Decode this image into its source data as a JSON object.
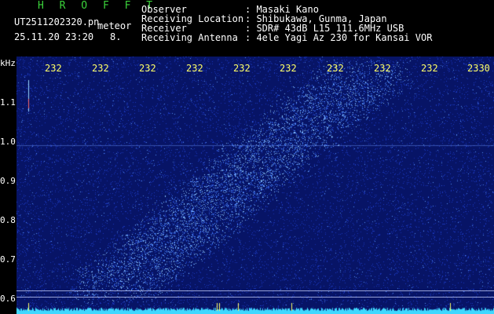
{
  "header": {
    "title": "H R O F F T",
    "filename": "UT2511202320.pn",
    "meteor_label": "meteor",
    "timestamp": "25.11.20 23:20",
    "count": "8.",
    "fields": [
      {
        "label": "Observer",
        "value": ": Masaki Kano"
      },
      {
        "label": "Receiving Location",
        "value": ": Shibukawa, Gunma, Japan"
      },
      {
        "label": "Receiver",
        "value": ": SDR# 43dB L15 111.6MHz USB"
      },
      {
        "label": "Receiving Antenna",
        "value": ": 4ele Yagi Az 230 for Kansai VOR"
      }
    ]
  },
  "axis": {
    "unit": "kHz",
    "y_ticks": [
      "1.1",
      "1.0",
      "0.9",
      "0.8",
      "0.7",
      "0.6"
    ],
    "x_ticks": [
      "232",
      "232",
      "232",
      "232",
      "232",
      "232",
      "232",
      "232",
      "232",
      "2330"
    ]
  },
  "colors": {
    "background": "#000000",
    "spectrogram": "#0a1a7a",
    "signal": "#4aa8ff",
    "noise_floor": "#3fd8ff",
    "axis_labels": "#ffff66",
    "title": "#3bd23b"
  }
}
